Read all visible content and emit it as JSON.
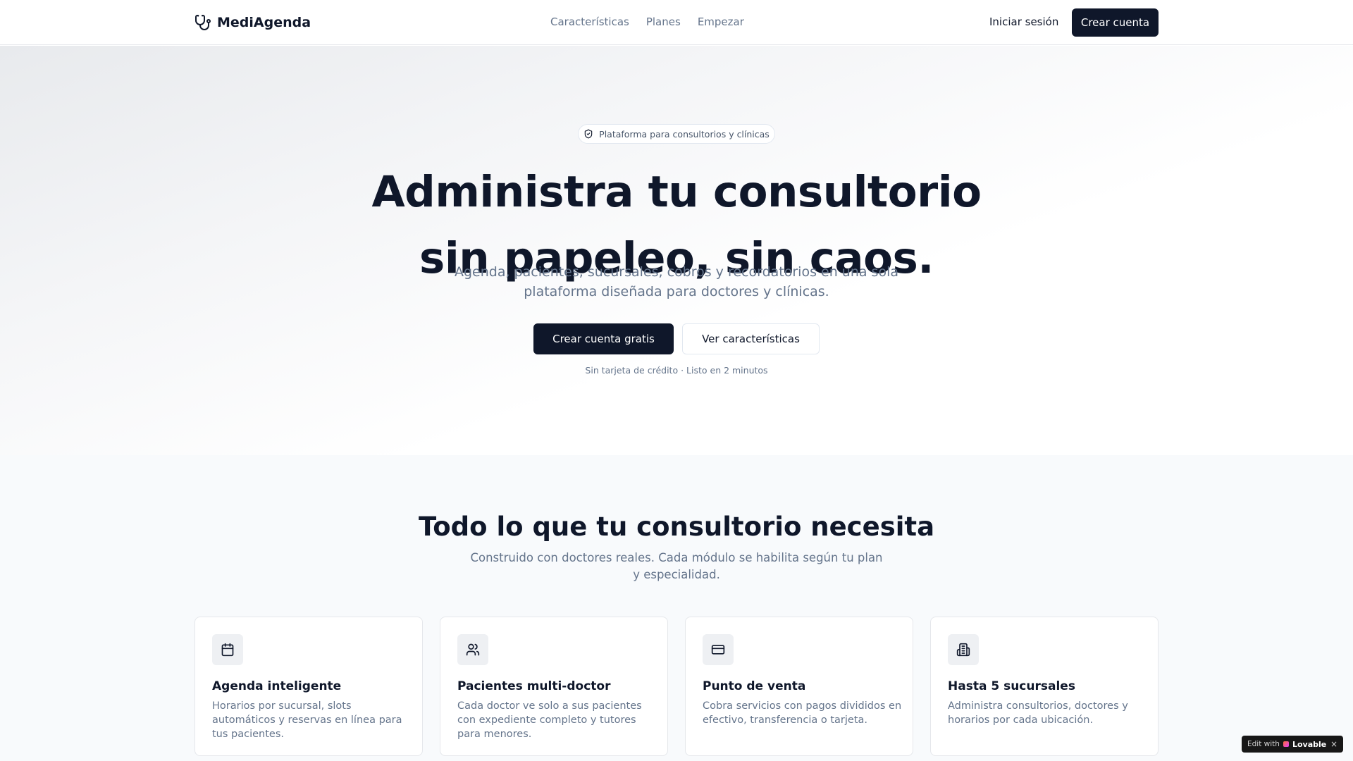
{
  "nav": {
    "brand": "MediAgenda",
    "links": [
      "Características",
      "Planes",
      "Empezar"
    ],
    "login": "Iniciar sesión",
    "signup": "Crear cuenta"
  },
  "hero": {
    "pill": "Plataforma para consultorios y clínicas",
    "title_line1": "Administra tu consultorio",
    "title_line2": "sin papeleo, sin caos.",
    "subtitle_line1": "Agenda, pacientes, sucursales, cobros y recordatorios en una sola",
    "subtitle_line2": "plataforma diseñada para doctores y clínicas.",
    "cta_primary": "Crear cuenta gratis",
    "cta_secondary": "Ver características",
    "note": "Sin tarjeta de crédito · Listo en 2 minutos"
  },
  "features": {
    "title": "Todo lo que tu consultorio necesita",
    "subtitle_line1": "Construido con doctores reales. Cada módulo se habilita según tu plan",
    "subtitle_line2": "y especialidad.",
    "cards": [
      {
        "icon": "calendar-icon",
        "title": "Agenda inteligente",
        "desc": "Horarios por sucursal, slots automáticos y reservas en línea para tus pacientes."
      },
      {
        "icon": "users-icon",
        "title": "Pacientes multi-doctor",
        "desc": "Cada doctor ve solo a sus pacientes con expediente completo y tutores para menores."
      },
      {
        "icon": "credit-card-icon",
        "title": "Punto de venta",
        "desc": "Cobra servicios con pagos divididos en efectivo, transferencia o tarjeta."
      },
      {
        "icon": "building-icon",
        "title": "Hasta 5 sucursales",
        "desc": "Administra consultorios, doctores y horarios por cada ubicación."
      }
    ]
  },
  "badge": {
    "prefix": "Edit with",
    "brand": "Lovable",
    "close": "×"
  },
  "colors": {
    "primary": "#0f172a",
    "muted_text": "#64748b",
    "border": "#e5e7eb",
    "section_bg": "#f8fafc"
  }
}
